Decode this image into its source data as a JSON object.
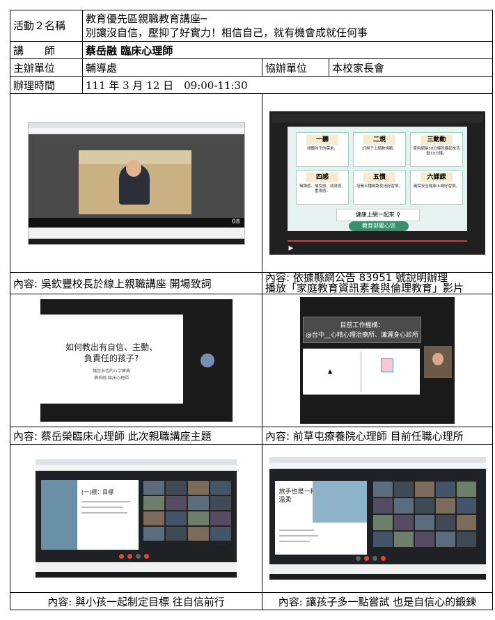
{
  "activity_label": "活動２名稱",
  "activity_title_line1": "教育優先區親職教育講座─",
  "activity_title_line2": "別讓沒自信，壓抑了好實力！相信自己，就有機會成就任何事",
  "speaker_label": "講　　師",
  "speaker_value": "蔡岳融 臨床心理師",
  "organizer_label": "主辦單位",
  "organizer_value": "輔導處",
  "coorganizer_label": "協辦單位",
  "coorganizer_value": "本校家長會",
  "time_label": "辦理時間",
  "time_value": "111 年 3 月 12 日　09:00-11:30",
  "photos": {
    "p1": {
      "caption": "內容: 吳欽豐校長於線上親職講座 開場致詞",
      "video_tag": "08"
    },
    "p2": {
      "caption_line1": "內容: 依據縣網公告 83951 號說明辦理",
      "caption_line2": "播放「家庭教育資訊素養與倫理教育」影片",
      "cards": [
        {
          "title": "一聽",
          "text": "傾聽孩子的需求。"
        },
        {
          "title": "二規",
          "text": "訂規子上網教規範。"
        },
        {
          "title": "三動動",
          "text": "使用網路30分鐘就要起來活動10分鐘。"
        },
        {
          "title": "四感",
          "text": "稱讚感、愉悅感、成就感、重視感。"
        },
        {
          "title": "五慣",
          "text": "培養五種網路使用好習慣。"
        },
        {
          "title": "六課課",
          "text": "確保安全健康上網好習慣。"
        }
      ],
      "slogan": "健康上網一起來",
      "brand": "教育部關心您"
    },
    "p3": {
      "caption": "內容: 蔡岳榮臨床心理師 此次親職講座主題",
      "slide_line1": "如何教出有自信、主動、",
      "slide_line2": "負責任的孩子?",
      "slide_sub1": "讓您自信的八字寶典",
      "slide_sub2": "蔡岳融 臨床心理師"
    },
    "p4": {
      "caption": "內容: 前草屯療養院心理師 目前任職心理所",
      "banner_line1": "目前工作機構：",
      "banner_line2": "@台中__心晴心理治療所、瀟灑身心診所"
    },
    "p5": {
      "caption": "內容: 與小孩一起制定目標 往自信前行",
      "slide_title": "(一)標：目標"
    },
    "p6": {
      "caption": "內容: 讓孩子多一點嘗試 也是自信心的鍛鍊",
      "slide_title_line1": "放手也是一種",
      "slide_title_line2": "溫柔"
    }
  }
}
